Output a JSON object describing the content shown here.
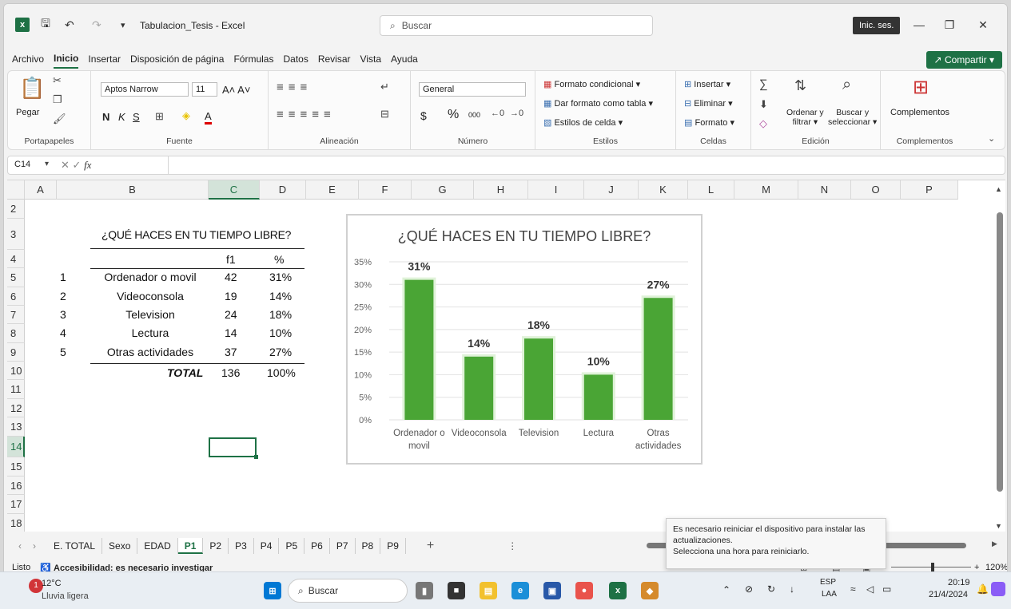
{
  "window": {
    "title": "Tabulacion_Tesis  -  Excel",
    "search_placeholder": "Buscar",
    "signin_label": "Inic. ses."
  },
  "menu": {
    "tabs": [
      "Archivo",
      "Inicio",
      "Insertar",
      "Disposición de página",
      "Fórmulas",
      "Datos",
      "Revisar",
      "Vista",
      "Ayuda"
    ],
    "share_label": "Compartir"
  },
  "ribbon": {
    "portapapeles": {
      "label": "Portapapeles",
      "paste": "Pegar"
    },
    "fuente": {
      "label": "Fuente",
      "font_name": "Aptos Narrow",
      "font_size": "11",
      "bold": "N",
      "italic": "K",
      "underline": "S"
    },
    "alineacion": {
      "label": "Alineación"
    },
    "numero": {
      "label": "Número",
      "format": "General",
      "currency": "$",
      "percent": "%",
      "thousands": "000"
    },
    "estilos": {
      "label": "Estilos",
      "cond": "Formato condicional",
      "table": "Dar formato como tabla",
      "cell": "Estilos de celda"
    },
    "celdas": {
      "label": "Celdas",
      "insert": "Insertar",
      "delete": "Eliminar",
      "format": "Formato"
    },
    "edicion": {
      "label": "Edición",
      "sort": "Ordenar y",
      "sort2": "filtrar",
      "find": "Buscar y",
      "find2": "seleccionar"
    },
    "complementos": {
      "label": "Complementos",
      "button": "Complementos"
    }
  },
  "formula_bar": {
    "name_box": "C14",
    "fx": "fx",
    "formula": ""
  },
  "grid": {
    "columns": [
      "A",
      "B",
      "C",
      "D",
      "E",
      "F",
      "G",
      "H",
      "I",
      "J",
      "K",
      "L",
      "M",
      "N",
      "O",
      "P"
    ],
    "rows": [
      "2",
      "3",
      "4",
      "5",
      "6",
      "7",
      "8",
      "9",
      "10",
      "11",
      "12",
      "13",
      "14",
      "15",
      "16",
      "17",
      "18"
    ],
    "selected_cell": "C14"
  },
  "table": {
    "title": "¿QUÉ HACES EN TU TIEMPO LIBRE?",
    "header_f1": "f1",
    "header_pct": "%",
    "rows": [
      {
        "n": "1",
        "activity": "Ordenador o movil",
        "f1": "42",
        "pct": "31%"
      },
      {
        "n": "2",
        "activity": "Videoconsola",
        "f1": "19",
        "pct": "14%"
      },
      {
        "n": "3",
        "activity": "Television",
        "f1": "24",
        "pct": "18%"
      },
      {
        "n": "4",
        "activity": "Lectura",
        "f1": "14",
        "pct": "10%"
      },
      {
        "n": "5",
        "activity": "Otras actividades",
        "f1": "37",
        "pct": "27%"
      }
    ],
    "total_label": "TOTAL",
    "total_f1": "136",
    "total_pct": "100%"
  },
  "chart_data": {
    "type": "bar",
    "title": "¿QUÉ HACES EN TU TIEMPO LIBRE?",
    "categories": [
      "Ordenador o movil",
      "Videoconsola",
      "Television",
      "Lectura",
      "Otras actividades"
    ],
    "values": [
      31,
      14,
      18,
      10,
      27
    ],
    "data_labels": [
      "31%",
      "14%",
      "18%",
      "10%",
      "27%"
    ],
    "ytick_labels": [
      "0%",
      "5%",
      "10%",
      "15%",
      "20%",
      "25%",
      "30%",
      "35%"
    ],
    "ylim": [
      0,
      35
    ],
    "grid": true,
    "bar_color": "#4aa535"
  },
  "sheets": {
    "tabs": [
      "E. TOTAL",
      "Sexo",
      "EDAD",
      "P1",
      "P2",
      "P3",
      "P4",
      "P5",
      "P6",
      "P7",
      "P8",
      "P9"
    ],
    "active": "P1",
    "add": "+"
  },
  "status": {
    "ready": "Listo",
    "accessibility": "Accesibilidad: es necesario investigar",
    "zoom": "120%"
  },
  "toast": {
    "line1": "Es necesario reiniciar el dispositivo para instalar las actualizaciones.",
    "line2": "Selecciona una hora para reiniciarlo."
  },
  "taskbar": {
    "weather_temp": "12°C",
    "weather_desc": "Lluvia ligera",
    "search": "Buscar",
    "lang1": "ESP",
    "lang2": "LAA",
    "time": "20:19",
    "date": "21/4/2024"
  }
}
